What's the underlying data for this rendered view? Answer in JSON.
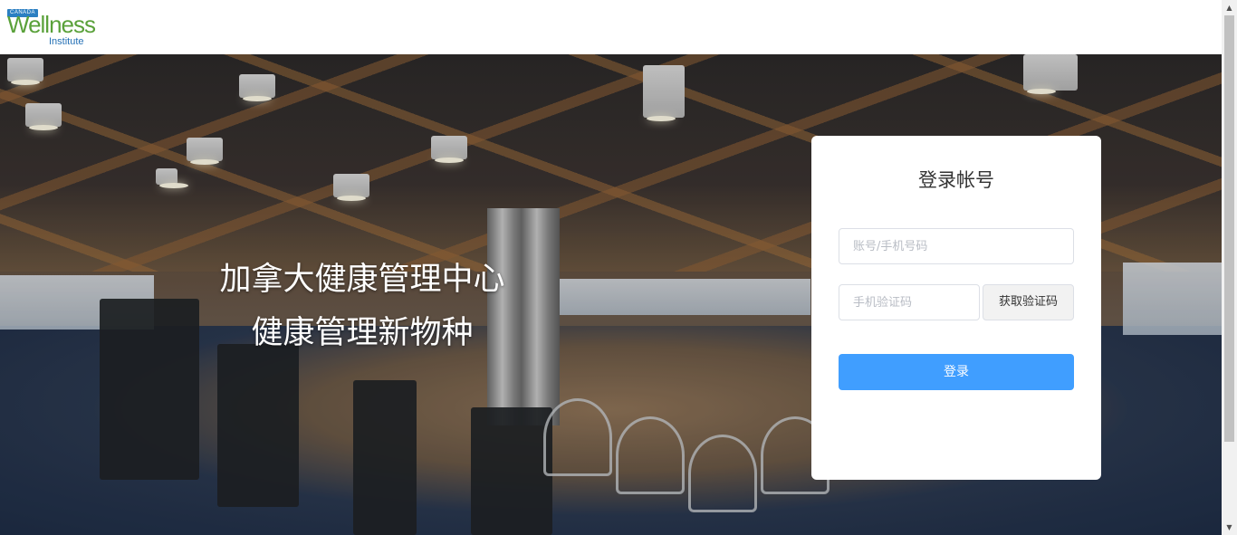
{
  "header": {
    "logo": {
      "top_text": "CANADA",
      "main_text": "Wellness",
      "sub_text": "Institute"
    }
  },
  "hero": {
    "slogan_line1": "加拿大健康管理中心",
    "slogan_line2": "健康管理新物种"
  },
  "login": {
    "title": "登录帐号",
    "account_placeholder": "账号/手机号码",
    "code_placeholder": "手机验证码",
    "get_code_label": "获取验证码",
    "submit_label": "登录"
  },
  "colors": {
    "primary": "#409eff",
    "logo_green": "#5aa13a",
    "logo_blue": "#1f6fb2"
  },
  "icons": {
    "scroll_up": "triangle-up",
    "scroll_down": "triangle-down"
  }
}
